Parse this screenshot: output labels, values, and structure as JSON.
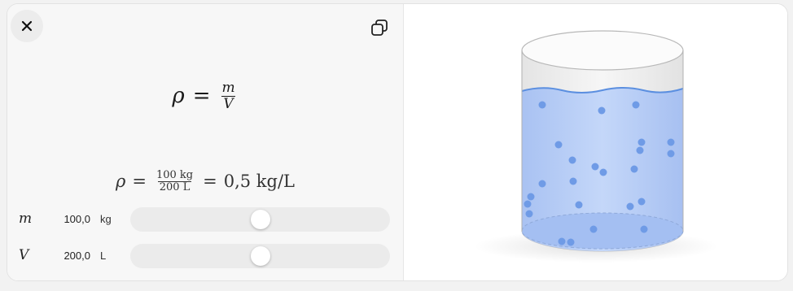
{
  "toolbar": {
    "close_icon": "close-icon",
    "copy_icon": "copy-icon"
  },
  "formula": {
    "lhs": "ρ",
    "equals": "=",
    "numerator": "m",
    "denominator": "V"
  },
  "calculation": {
    "lhs": "ρ",
    "equals1": "=",
    "numerator": "100 kg",
    "denominator": "200 L",
    "equals2": "=",
    "result": "0,5 kg/L"
  },
  "sliders": [
    {
      "symbol": "m",
      "value": "100,0",
      "unit": "kg",
      "fraction": 0.5
    },
    {
      "symbol": "V",
      "value": "200,0",
      "unit": "L",
      "fraction": 0.5
    }
  ],
  "colors": {
    "water": "#b6cdf7",
    "water_line": "#5b8fe0",
    "particle": "#6f9be6"
  }
}
